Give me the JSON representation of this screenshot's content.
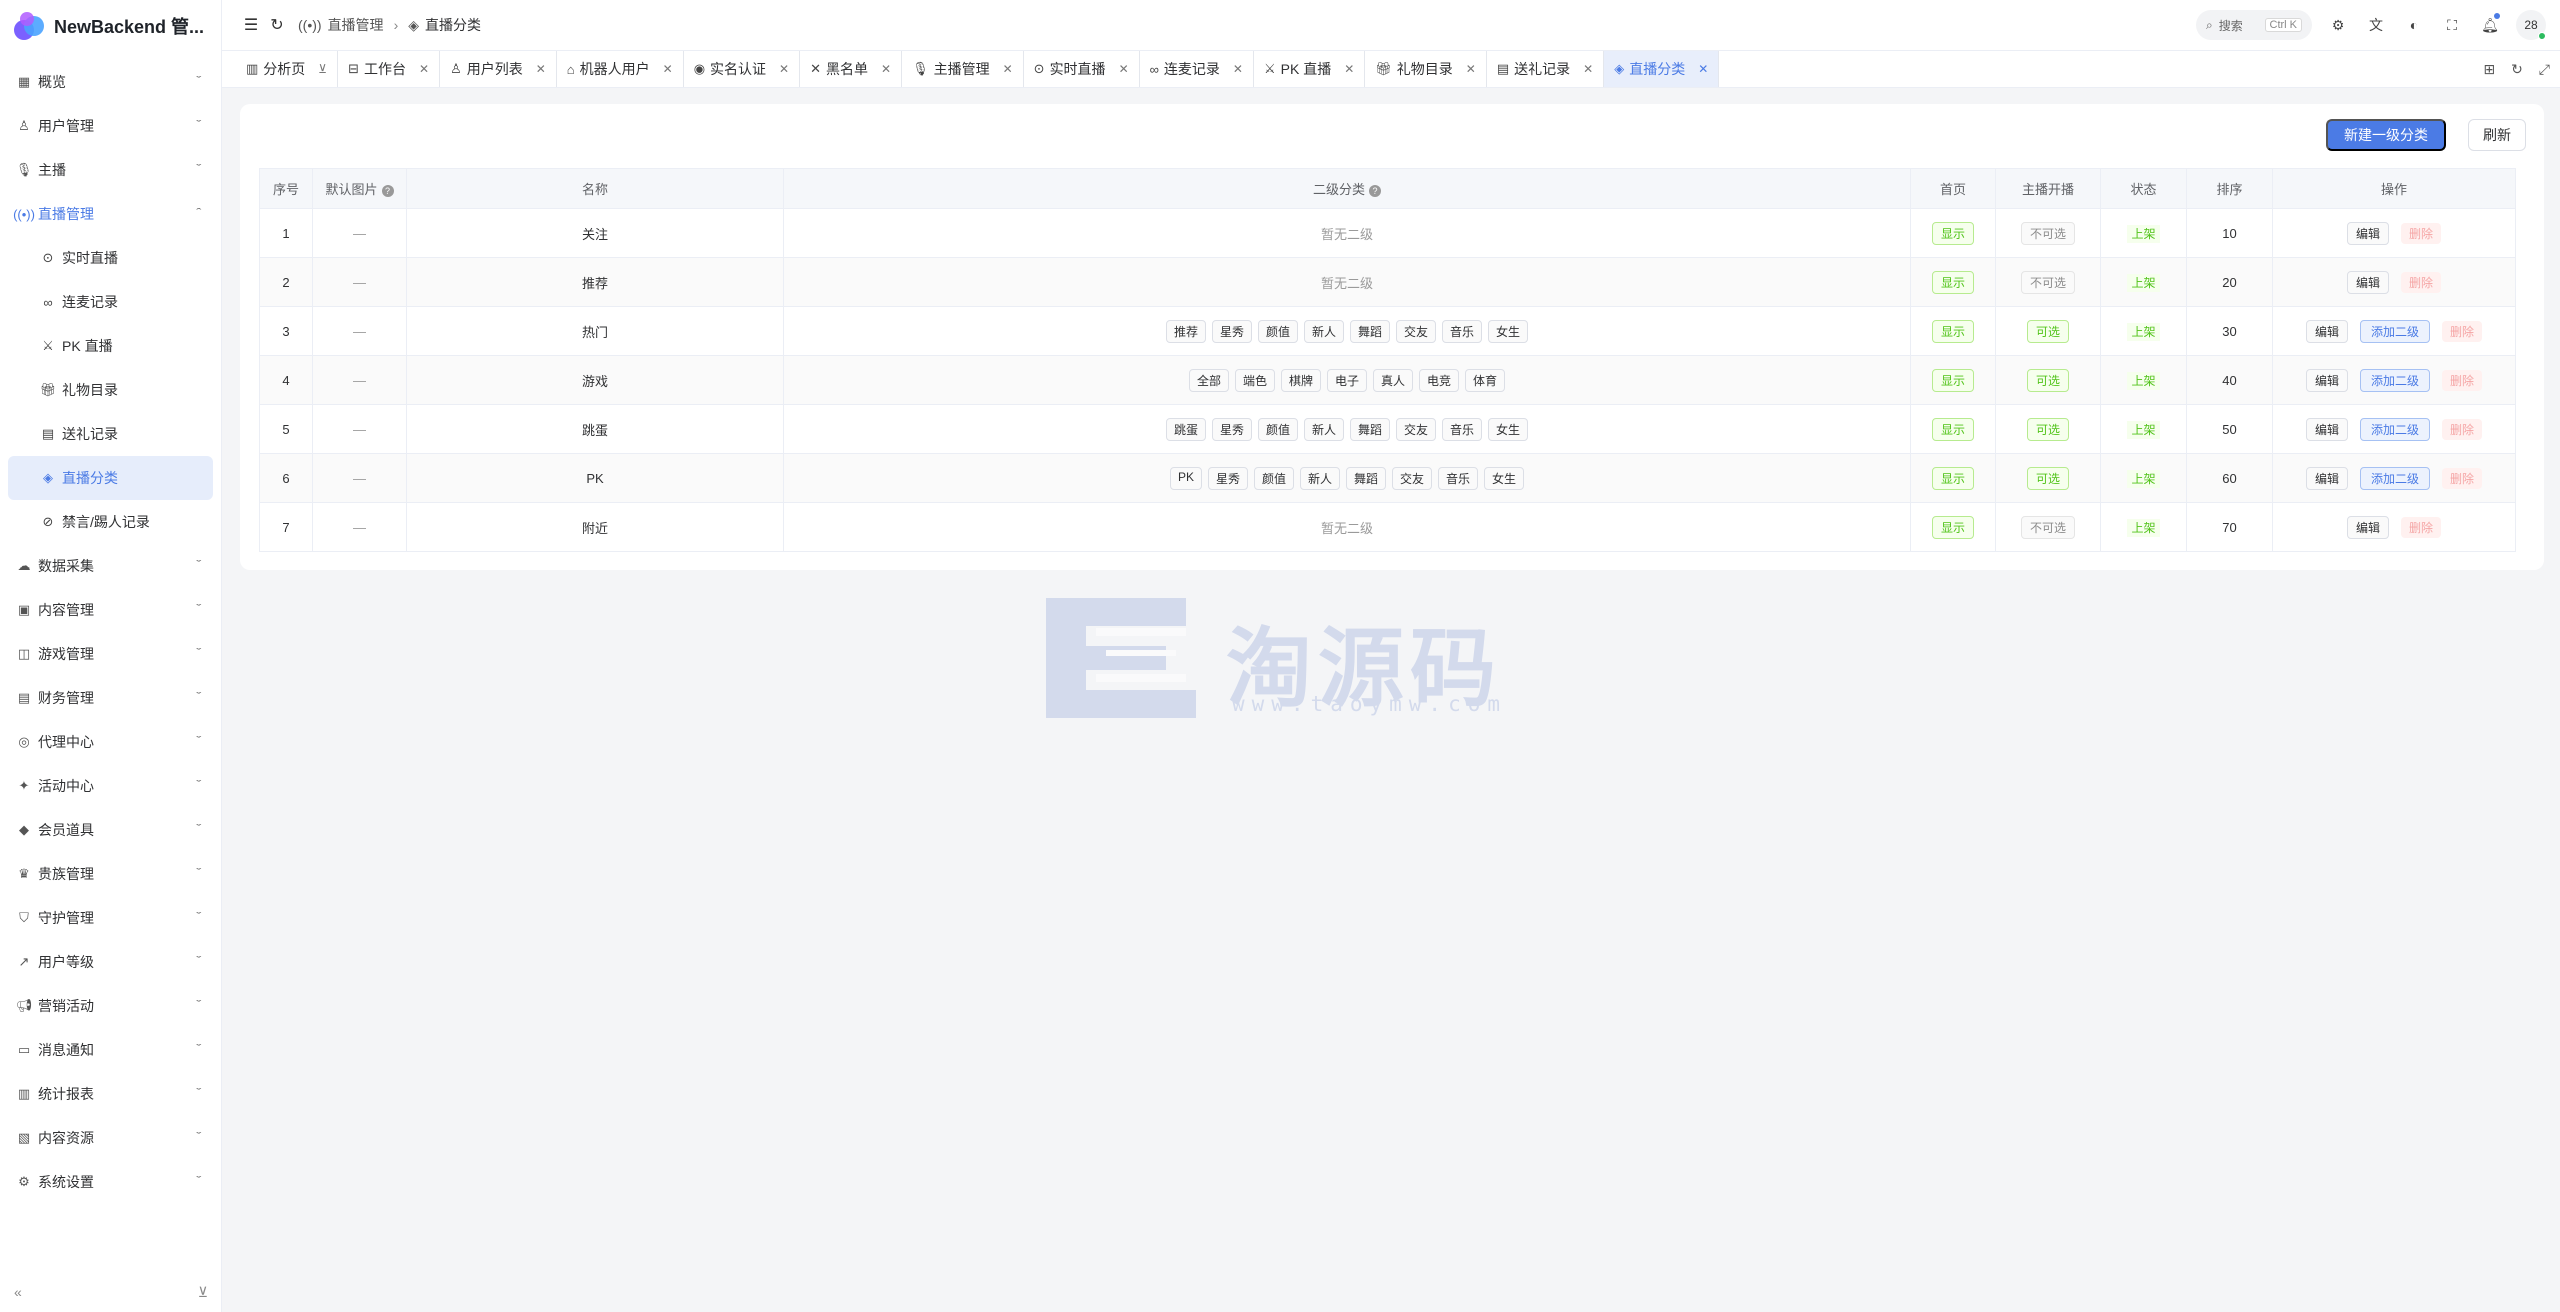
{
  "brand": {
    "title": "NewBackend 管..."
  },
  "sidebar": {
    "items": [
      {
        "label": "概览",
        "icon": "grid-icon"
      },
      {
        "label": "用户管理",
        "icon": "user-icon"
      },
      {
        "label": "主播",
        "icon": "mic-icon"
      },
      {
        "label": "直播管理",
        "icon": "broadcast-icon"
      },
      {
        "label": "数据采集",
        "icon": "cloud-icon"
      },
      {
        "label": "内容管理",
        "icon": "gallery-icon"
      },
      {
        "label": "游戏管理",
        "icon": "gamepad-icon"
      },
      {
        "label": "财务管理",
        "icon": "wallet-icon"
      },
      {
        "label": "代理中心",
        "icon": "badge-icon"
      },
      {
        "label": "活动中心",
        "icon": "sparkle-icon"
      },
      {
        "label": "会员道具",
        "icon": "diamond-icon"
      },
      {
        "label": "贵族管理",
        "icon": "crown-icon"
      },
      {
        "label": "守护管理",
        "icon": "shield-icon"
      },
      {
        "label": "用户等级",
        "icon": "trend-icon"
      },
      {
        "label": "营销活动",
        "icon": "megaphone-icon"
      },
      {
        "label": "消息通知",
        "icon": "message-icon"
      },
      {
        "label": "统计报表",
        "icon": "chart-icon"
      },
      {
        "label": "内容资源",
        "icon": "folder-icon"
      },
      {
        "label": "系统设置",
        "icon": "gear-icon"
      }
    ],
    "sub_items": [
      {
        "label": "实时直播",
        "icon": "play-circle-icon"
      },
      {
        "label": "连麦记录",
        "icon": "link-icon"
      },
      {
        "label": "PK 直播",
        "icon": "swords-icon"
      },
      {
        "label": "礼物目录",
        "icon": "gift-icon"
      },
      {
        "label": "送礼记录",
        "icon": "doc-icon"
      },
      {
        "label": "直播分类",
        "icon": "layers-icon"
      },
      {
        "label": "禁言/踢人记录",
        "icon": "user-ban-icon"
      }
    ]
  },
  "header": {
    "breadcrumb": [
      "直播管理",
      "直播分类"
    ],
    "search_label": "搜索",
    "search_kbd": "Ctrl K",
    "avatar_text": "28"
  },
  "tabs": [
    {
      "label": "分析页",
      "icon": "chart-icon",
      "pinned": true
    },
    {
      "label": "工作台",
      "icon": "workbench-icon"
    },
    {
      "label": "用户列表",
      "icon": "user-icon"
    },
    {
      "label": "机器人用户",
      "icon": "robot-icon"
    },
    {
      "label": "实名认证",
      "icon": "id-icon"
    },
    {
      "label": "黑名单",
      "icon": "user-x-icon"
    },
    {
      "label": "主播管理",
      "icon": "mic-icon"
    },
    {
      "label": "实时直播",
      "icon": "play-circle-icon"
    },
    {
      "label": "连麦记录",
      "icon": "link-icon"
    },
    {
      "label": "PK 直播",
      "icon": "swords-icon"
    },
    {
      "label": "礼物目录",
      "icon": "gift-icon"
    },
    {
      "label": "送礼记录",
      "icon": "doc-icon"
    },
    {
      "label": "直播分类",
      "icon": "layers-icon",
      "active": true
    }
  ],
  "toolbar": {
    "new_label": "新建一级分类",
    "refresh_label": "刷新"
  },
  "table": {
    "headers": [
      "序号",
      "默认图片",
      "名称",
      "二级分类",
      "首页",
      "主播开播",
      "状态",
      "排序",
      "操作"
    ],
    "rows": [
      {
        "idx": "1",
        "img": "—",
        "name": "关注",
        "subs": [],
        "empty_text": "暂无二级",
        "home": "显示",
        "open": "不可选",
        "status": "上架",
        "sort": "10"
      },
      {
        "idx": "2",
        "img": "—",
        "name": "推荐",
        "subs": [],
        "empty_text": "暂无二级",
        "home": "显示",
        "open": "不可选",
        "status": "上架",
        "sort": "20"
      },
      {
        "idx": "3",
        "img": "—",
        "name": "热门",
        "subs": [
          "推荐",
          "星秀",
          "颜值",
          "新人",
          "舞蹈",
          "交友",
          "音乐",
          "女生"
        ],
        "home": "显示",
        "open": "可选",
        "status": "上架",
        "sort": "30"
      },
      {
        "idx": "4",
        "img": "—",
        "name": "游戏",
        "subs": [
          "全部",
          "端色",
          "棋牌",
          "电子",
          "真人",
          "电竞",
          "体育"
        ],
        "home": "显示",
        "open": "可选",
        "status": "上架",
        "sort": "40"
      },
      {
        "idx": "5",
        "img": "—",
        "name": "跳蛋",
        "subs": [
          "跳蛋",
          "星秀",
          "颜值",
          "新人",
          "舞蹈",
          "交友",
          "音乐",
          "女生"
        ],
        "home": "显示",
        "open": "可选",
        "status": "上架",
        "sort": "50"
      },
      {
        "idx": "6",
        "img": "—",
        "name": "PK",
        "subs": [
          "PK",
          "星秀",
          "颜值",
          "新人",
          "舞蹈",
          "交友",
          "音乐",
          "女生"
        ],
        "home": "显示",
        "open": "可选",
        "status": "上架",
        "sort": "60"
      },
      {
        "idx": "7",
        "img": "—",
        "name": "附近",
        "subs": [],
        "empty_text": "暂无二级",
        "home": "显示",
        "open": "不可选",
        "status": "上架",
        "sort": "70"
      }
    ],
    "op_edit": "编辑",
    "op_add": "添加二级",
    "op_delete": "删除"
  },
  "watermark": {
    "text": "淘源码",
    "url": "www.taoymw.com"
  }
}
